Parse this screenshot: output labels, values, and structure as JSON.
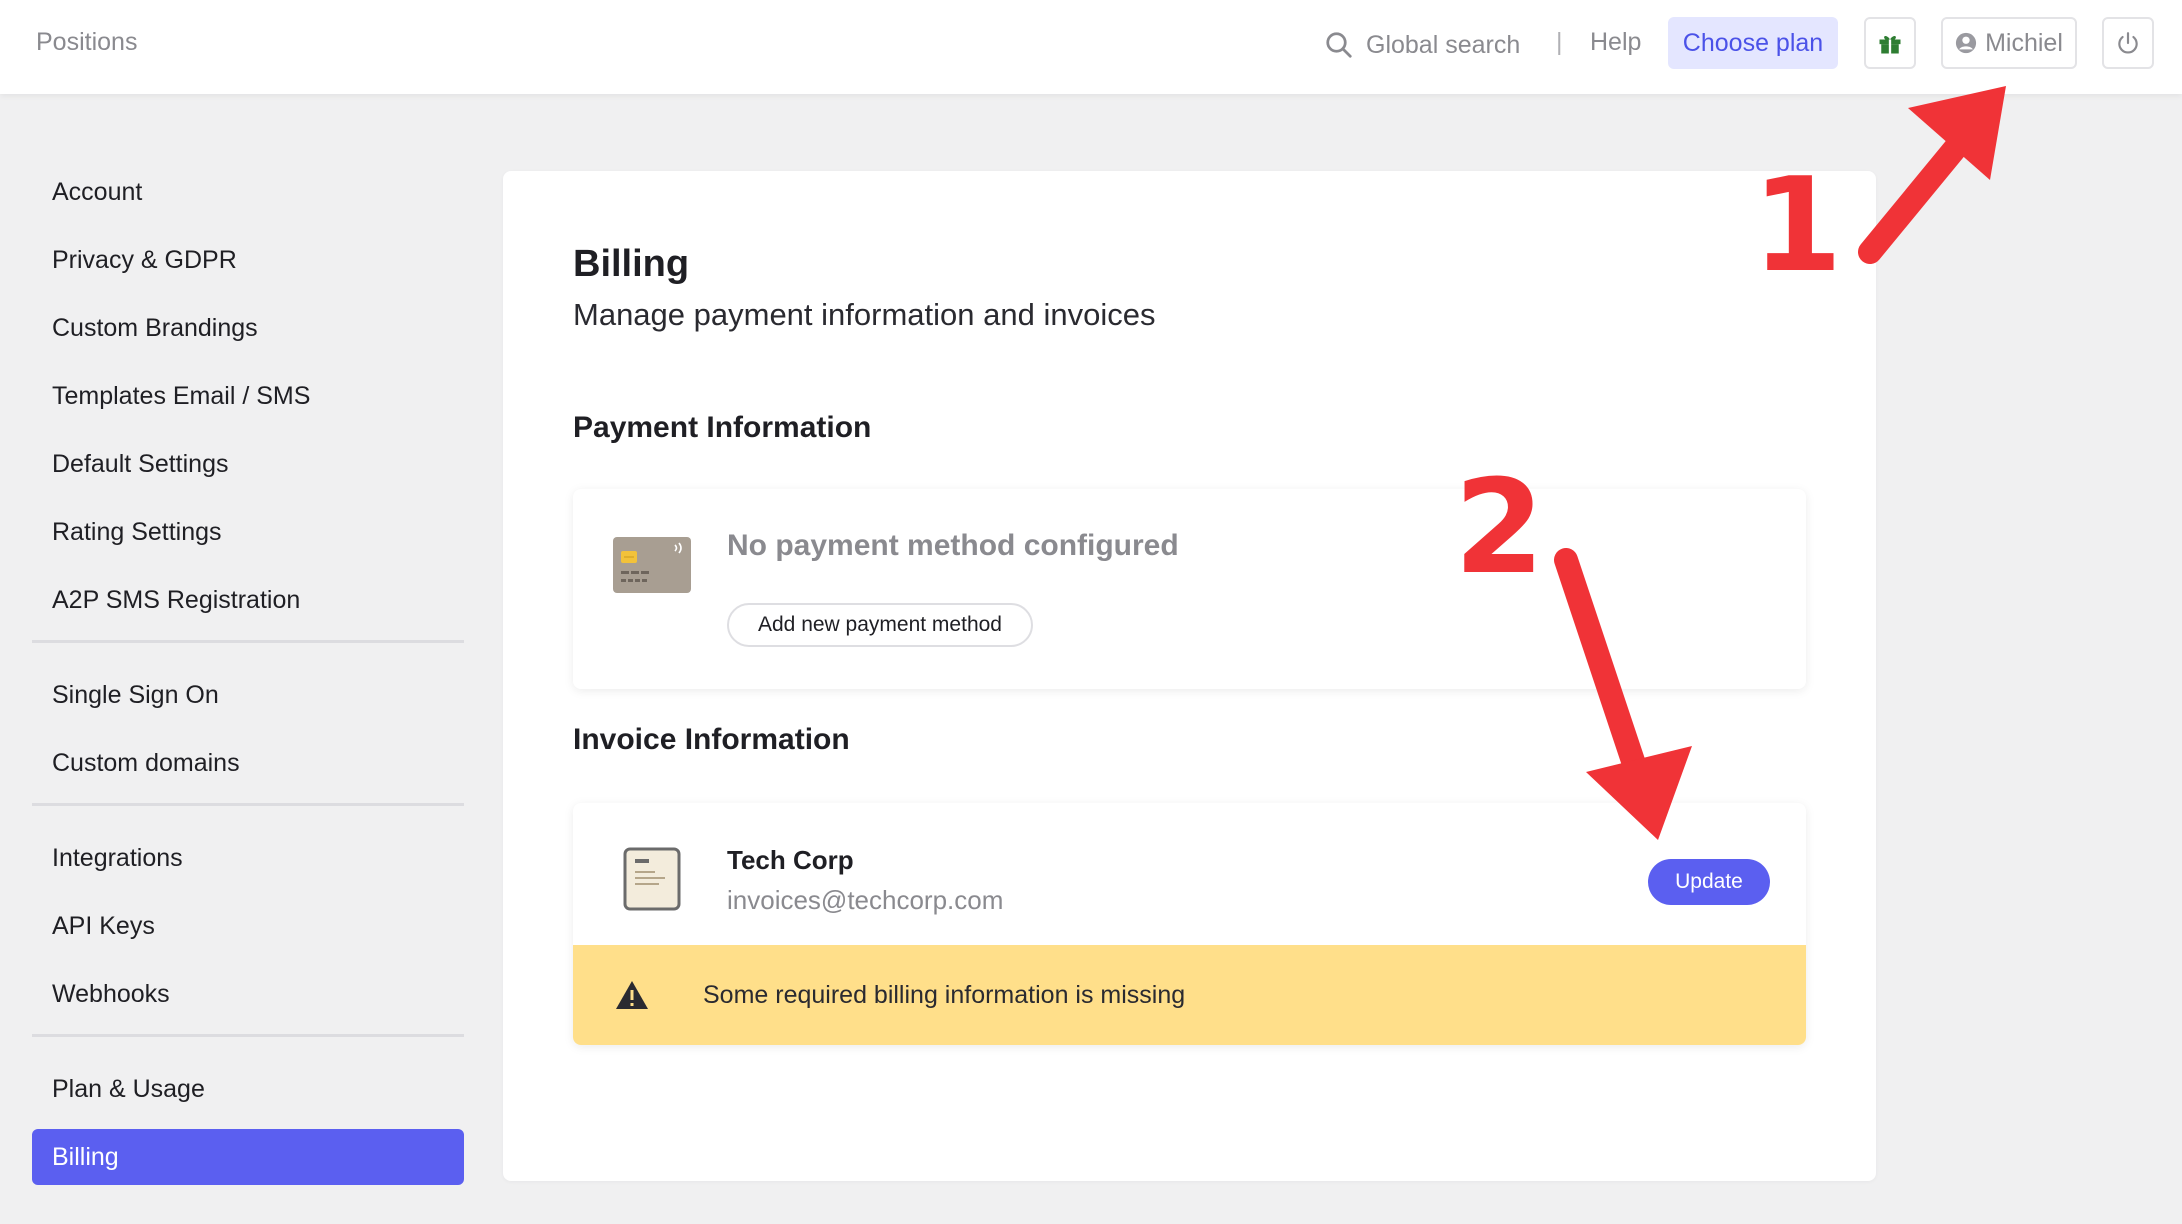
{
  "header": {
    "brand": "Positions",
    "search_label": "Global search",
    "separator": "|",
    "help_label": "Help",
    "choose_plan_label": "Choose plan",
    "user_name": "Michiel"
  },
  "sidebar": {
    "groups": [
      [
        "Account",
        "Privacy & GDPR",
        "Custom Brandings",
        "Templates Email / SMS",
        "Default Settings",
        "Rating Settings",
        "A2P SMS Registration"
      ],
      [
        "Single Sign On",
        "Custom domains"
      ],
      [
        "Integrations",
        "API Keys",
        "Webhooks"
      ],
      [
        "Plan & Usage",
        "Billing"
      ]
    ],
    "active": "Billing"
  },
  "main": {
    "title": "Billing",
    "subtitle": "Manage payment information and invoices",
    "payment": {
      "heading": "Payment Information",
      "status": "No payment method configured",
      "add_button": "Add new payment method"
    },
    "invoice": {
      "heading": "Invoice Information",
      "company": "Tech Corp",
      "email": "invoices@techcorp.com",
      "update_button": "Update",
      "warning": "Some required billing information is missing"
    }
  },
  "annotations": {
    "marker_1": "1",
    "marker_2": "2",
    "color": "#f03337"
  },
  "colors": {
    "accent": "#5b5ff0",
    "warning_bg": "#ffdf8a",
    "choose_plan_bg": "#e4e6ff",
    "gift_green": "#2e7d32"
  }
}
